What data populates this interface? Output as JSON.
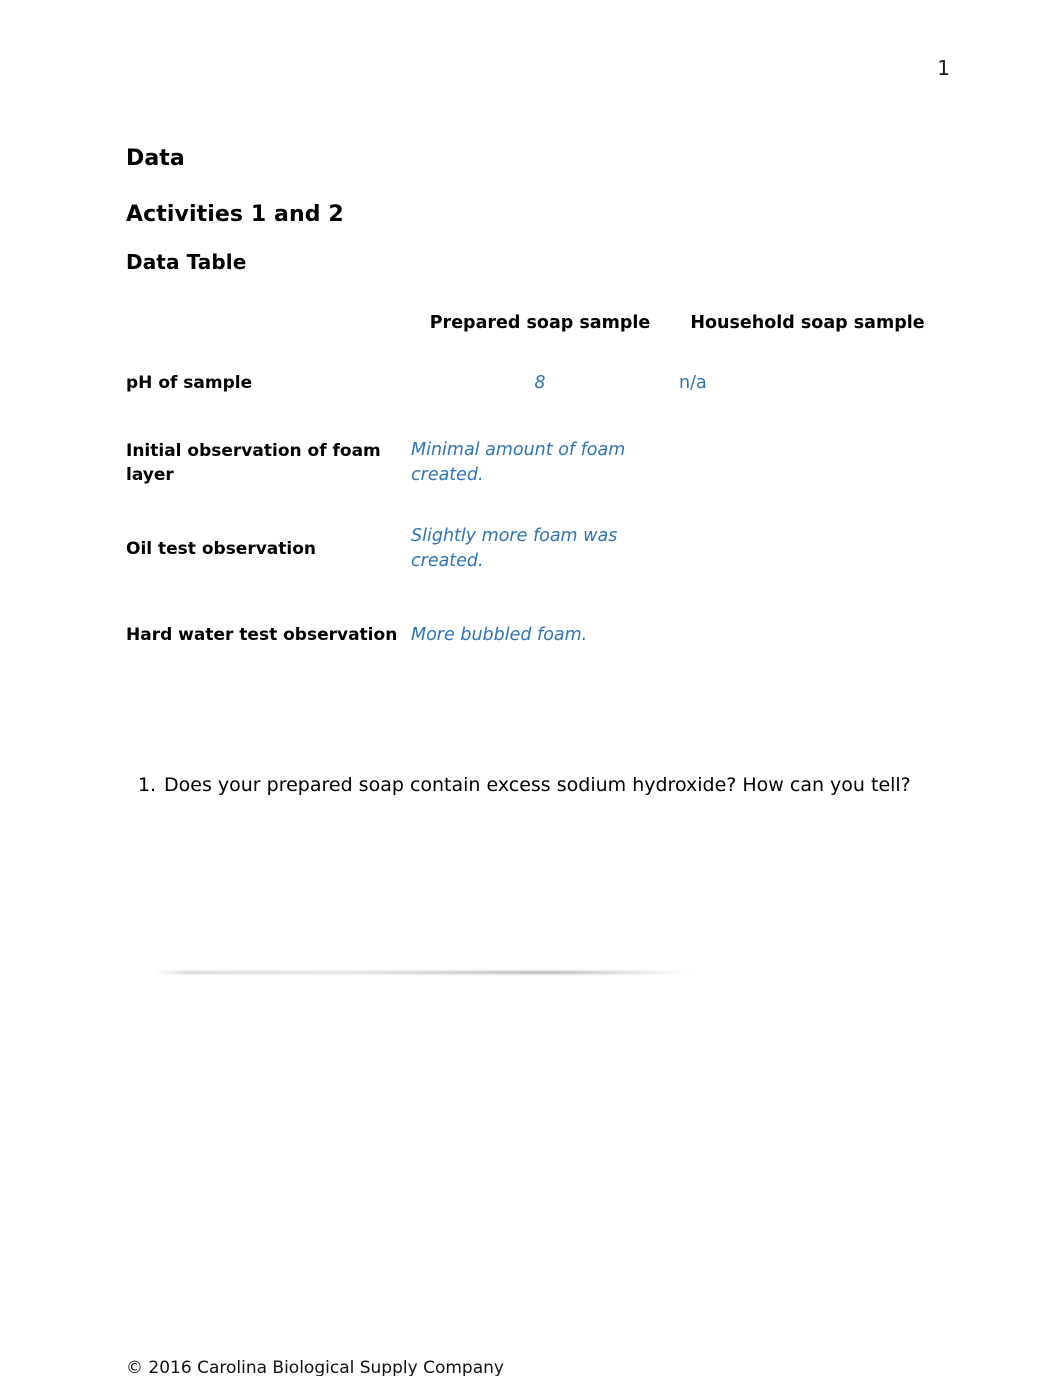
{
  "document": {
    "page_number": "1",
    "headings": {
      "section": "Data",
      "activities": "Activities 1 and 2",
      "table_title": "Data Table"
    },
    "footer": "© 2016 Carolina Biological Supply Company"
  },
  "table": {
    "columns": [
      {
        "key": "label",
        "header": ""
      },
      {
        "key": "prepared",
        "header": "Prepared soap sample"
      },
      {
        "key": "household",
        "header": "Household soap sample"
      }
    ],
    "rows": [
      {
        "label": "pH of sample",
        "prepared": "8",
        "household": "n/a"
      },
      {
        "label": "Initial observation of foam layer",
        "prepared": "Minimal amount of foam created.",
        "household": ""
      },
      {
        "label": "Oil test observation",
        "prepared": "Slightly more foam was created.",
        "household": ""
      },
      {
        "label": "Hard water test observation",
        "prepared": "More bubbled foam.",
        "household": ""
      }
    ]
  },
  "questions": [
    {
      "number": "1.",
      "text": "Does your prepared soap contain excess sodium hydroxide? How can you tell?"
    }
  ],
  "colors": {
    "answer_text": "#2e74b5",
    "body_text": "#000000",
    "page_background": "#ffffff"
  }
}
